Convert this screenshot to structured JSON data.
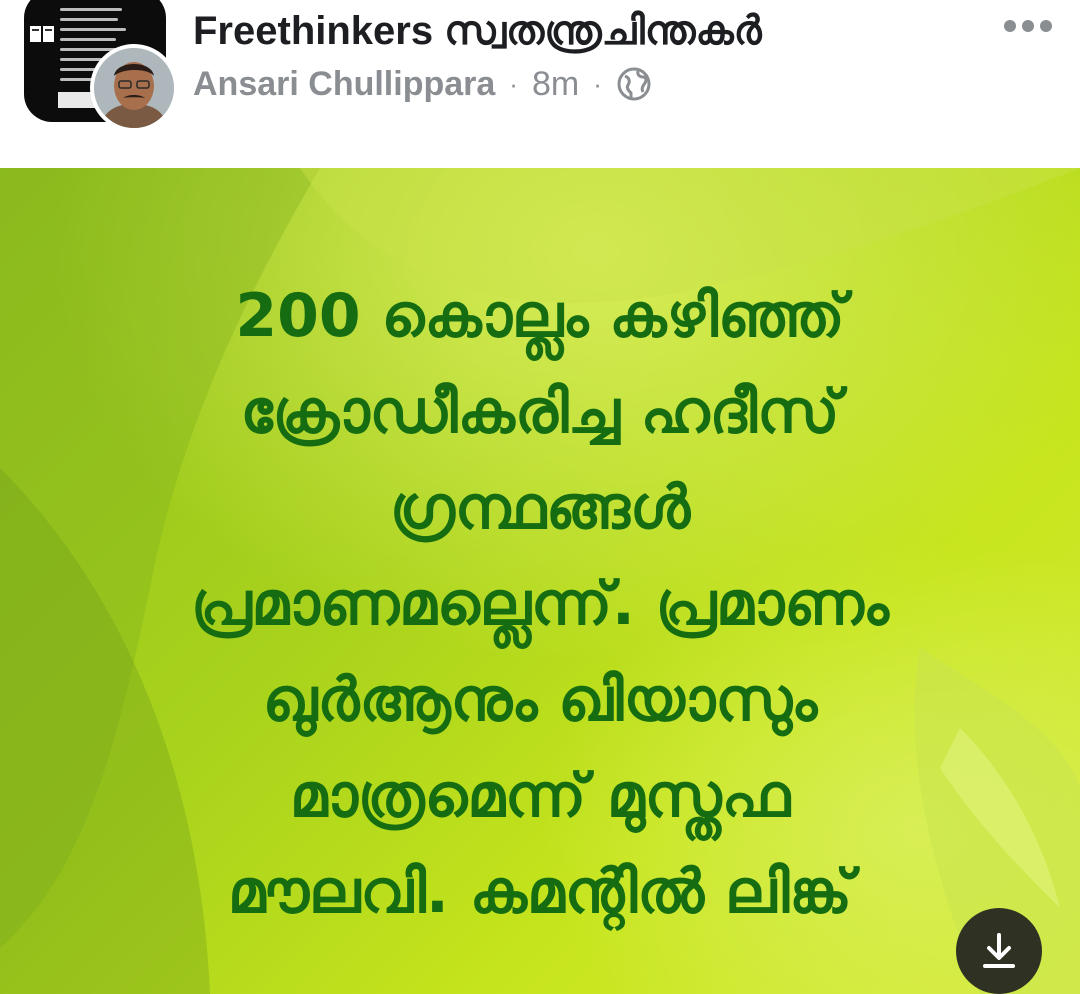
{
  "post": {
    "group_name": "Freethinkers സ്വതന്ത്രചിന്തകർ",
    "author": "Ansari Chullippara",
    "time": "8m",
    "separator": "·",
    "privacy_icon": "globe-icon",
    "more_icon": "more-horizontal-icon"
  },
  "image": {
    "caption_lines": [
      "200 കൊല്ലം കഴിഞ്ഞ്",
      "ക്രോഡീകരിച്ച ഹദീസ്",
      "ഗ്രന്ഥങ്ങൾ",
      "പ്രമാണമല്ലെന്ന്. പ്രമാണം",
      "ഖുർആനും ഖിയാസും",
      "മാത്രമെന്ന് മുസ്തഫ",
      "മൗലവി. കമന്റിൽ ലിങ്ക്"
    ],
    "download_icon": "download-icon"
  },
  "colors": {
    "caption": "#166d11",
    "image_green": "#a8d21c",
    "meta_gray": "#8a8d91",
    "title": "#1c1e21"
  }
}
